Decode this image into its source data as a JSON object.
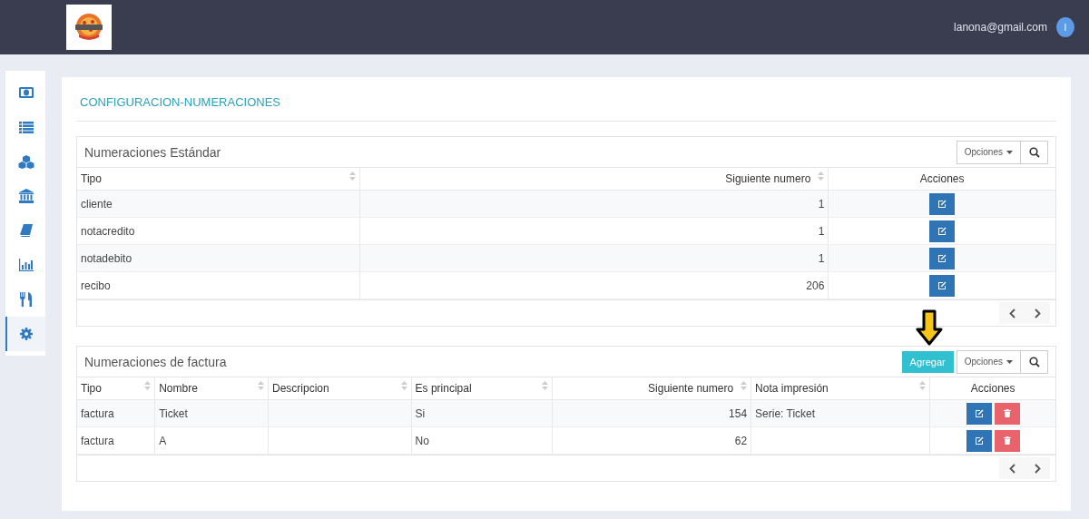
{
  "header": {
    "user_email": "lanona@gmail.com",
    "avatar_initial": "I"
  },
  "sidebar": {
    "items": [
      {
        "selected": false
      },
      {
        "selected": false
      },
      {
        "selected": false
      },
      {
        "selected": false
      },
      {
        "selected": false
      },
      {
        "selected": false
      },
      {
        "selected": false
      },
      {
        "selected": true
      }
    ]
  },
  "page": {
    "title": "CONFIGURACION-NUMERACIONES"
  },
  "panels": [
    {
      "title": "Numeraciones Estándar",
      "options_label": "Opciones",
      "columns": [
        {
          "label": "Tipo",
          "kind": "text",
          "sortable": true
        },
        {
          "label": "Siguiente numero",
          "kind": "number",
          "sortable": true
        },
        {
          "label": "Acciones",
          "kind": "actions",
          "sortable": false
        }
      ],
      "rows": [
        {
          "cells": [
            "cliente",
            "1"
          ],
          "actions": [
            {
              "kind": "edit"
            }
          ]
        },
        {
          "cells": [
            "notacredito",
            "1"
          ],
          "actions": [
            {
              "kind": "edit"
            }
          ]
        },
        {
          "cells": [
            "notadebito",
            "1"
          ],
          "actions": [
            {
              "kind": "edit"
            }
          ]
        },
        {
          "cells": [
            "recibo",
            "206"
          ],
          "actions": [
            {
              "kind": "edit"
            }
          ]
        }
      ]
    },
    {
      "title": "Numeraciones de factura",
      "add_button": "Agregar",
      "options_label": "Opciones",
      "columns": [
        {
          "label": "Tipo",
          "kind": "text",
          "sortable": true
        },
        {
          "label": "Nombre",
          "kind": "text",
          "sortable": true
        },
        {
          "label": "Descripcion",
          "kind": "text",
          "sortable": true
        },
        {
          "label": "Es principal",
          "kind": "text",
          "sortable": true
        },
        {
          "label": "Siguiente numero",
          "kind": "number",
          "sortable": true
        },
        {
          "label": "Nota impresión",
          "kind": "text",
          "sortable": true
        },
        {
          "label": "Acciones",
          "kind": "actions",
          "sortable": false
        }
      ],
      "rows": [
        {
          "cells": [
            "factura",
            "Ticket",
            "",
            "Si",
            "154",
            "Serie: Ticket"
          ],
          "actions": [
            {
              "kind": "edit"
            },
            {
              "kind": "delete"
            }
          ]
        },
        {
          "cells": [
            "factura",
            "A",
            "",
            "No",
            "62",
            ""
          ],
          "actions": [
            {
              "kind": "edit"
            },
            {
              "kind": "delete"
            }
          ]
        }
      ]
    }
  ]
}
